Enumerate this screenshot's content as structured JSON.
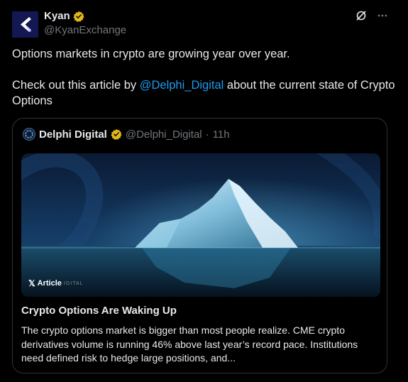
{
  "author": {
    "name": "Kyan",
    "handle": "@KyanExchange"
  },
  "post": {
    "line1": "Options markets in crypto are growing year over year.",
    "line2_before": "Check out this article by ",
    "mention": "@Delphi_Digital",
    "line2_after": " about the current state of Crypto Options"
  },
  "quoted": {
    "name": "Delphi Digital",
    "handle": "@Delphi_Digital",
    "separator": "·",
    "time": "11h",
    "badge_label": "Article",
    "badge_ghost": "IGITAL",
    "article_title": "Crypto Options Are Waking Up",
    "article_snippet": "The crypto options market is bigger than most people realize. CME crypto derivatives volume is running 46% above last year’s record pace. Institutions need defined risk to hedge large positions, and..."
  },
  "icons": {
    "verified": "verified-gold-badge-icon",
    "grok": "grok-icon",
    "more": "more-options-icon",
    "x_logo": "x-logo-icon"
  },
  "colors": {
    "background": "#000000",
    "text": "#e7e9ea",
    "muted": "#71767b",
    "link": "#1d9bf0",
    "gold": "#e2b719",
    "border": "#2f3336"
  }
}
